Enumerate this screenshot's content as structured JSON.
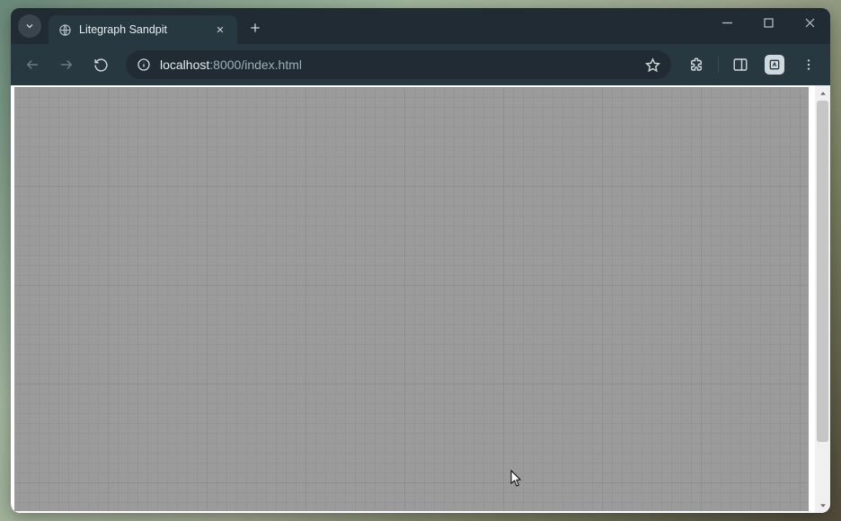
{
  "tab": {
    "title": "Litegraph Sandpit",
    "favicon": "globe-icon"
  },
  "url": {
    "host": "localhost",
    "port": ":8000",
    "path": "/index.html"
  },
  "icons": {
    "search_tabs": "chevron-down-icon",
    "new_tab": "plus-icon",
    "back": "arrow-left-icon",
    "forward": "arrow-right-icon",
    "reload": "reload-icon",
    "site_info": "info-icon",
    "bookmark": "star-icon",
    "extensions": "puzzle-icon",
    "side_panel": "panel-right-icon",
    "profile_ext": "ext-badge-icon",
    "menu": "dots-vertical-icon",
    "minimize": "minimize-icon",
    "maximize": "maximize-icon",
    "close_window": "close-icon",
    "close_tab": "close-icon"
  },
  "colors": {
    "chrome_dark": "#283840",
    "chrome_darker": "#202B33",
    "canvas_bg": "#9b9b9b"
  },
  "page": {
    "type": "litegraph-empty-canvas"
  }
}
